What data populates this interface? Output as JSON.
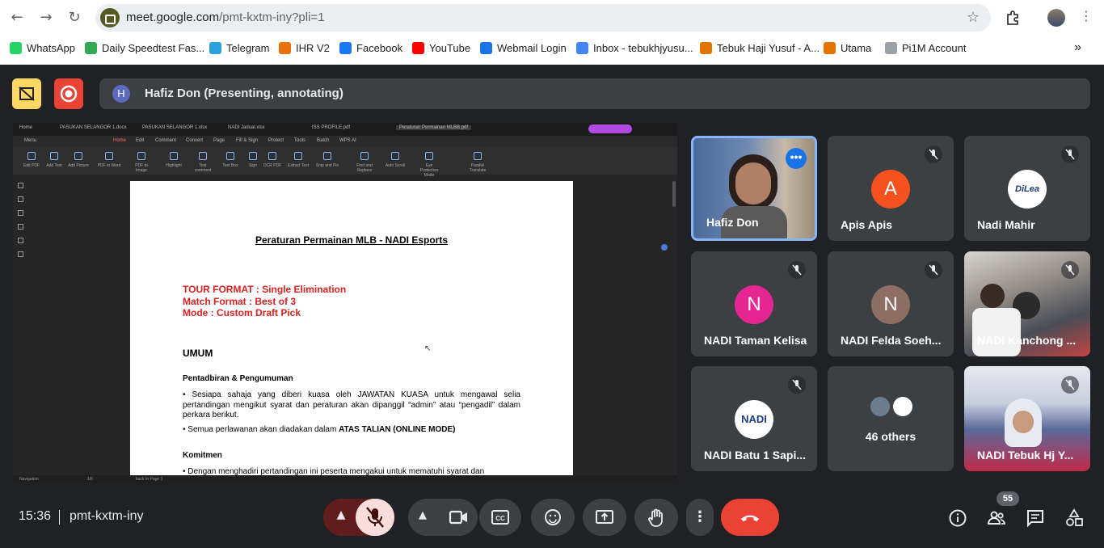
{
  "browser": {
    "url_host": "meet.google.com",
    "url_path": "/pmt-kxtm-iny?pli=1",
    "bookmarks": [
      {
        "label": "WhatsApp",
        "color": "#25d366"
      },
      {
        "label": "Daily Speedtest Fas...",
        "color": "#34a853"
      },
      {
        "label": "Telegram",
        "color": "#2aa1da"
      },
      {
        "label": "IHR V2",
        "color": "#e8710a"
      },
      {
        "label": "Facebook",
        "color": "#1877f2"
      },
      {
        "label": "YouTube",
        "color": "#ff0000"
      },
      {
        "label": "Webmail Login",
        "color": "#1a73e8"
      },
      {
        "label": "Inbox - tebukhjyusu...",
        "color": "#4285f4"
      },
      {
        "label": "Tebuk Haji Yusuf - A...",
        "color": "#e37400"
      },
      {
        "label": "Utama",
        "color": "#e37400"
      },
      {
        "label": "Pi1M Account",
        "color": "#9aa0a6"
      }
    ]
  },
  "presenter": {
    "initial": "H",
    "text": "Hafiz Don (Presenting, annotating)"
  },
  "screen": {
    "tabs": [
      "Home",
      "PASUKAN SELANGOR 1.docx",
      "PASUKAN SELANGOR 1.xlsx",
      "NADI Jadual.xlsx",
      "ISS PROFILE.pdf",
      "Peraturan Permainan MLBB.pdf"
    ],
    "menu": [
      "Menu",
      "Home",
      "Edit",
      "Comment",
      "Convert",
      "Page",
      "Fill & Sign",
      "Protect",
      "Tools",
      "Batch",
      "WPS AI"
    ],
    "ribbon": [
      "Edit PDF",
      "Add Text",
      "Add Picture",
      "PDF to Word",
      "PDF to Image",
      "Highlight",
      "Text comment",
      "Text Box",
      "Sign",
      "OCR PDF",
      "Extract Text",
      "Snip and Pin",
      "Find and Replace",
      "Auto Scroll",
      "Eye Protection Mode",
      "Parallel Translate"
    ],
    "status_left": "Navigation",
    "status_page": "1/6",
    "status_back": "back to Page 1",
    "doc": {
      "title": "Peraturan Permainan MLB - NADI Esports",
      "format_lines": [
        "TOUR FORMAT : Single Elimination",
        "Match Format : Best of 3",
        "Mode : Custom Draft Pick"
      ],
      "section": "UMUM",
      "sub1": "Pentadbiran & Pengumuman",
      "para1": "• Sesiapa sahaja yang diberi kuasa oleh JAWATAN KUASA untuk mengawal  selia pertandingan mengikut syarat dan peraturan akan dipanggil “admin” atau “pengadil” dalam perkara berikut.",
      "para2_prefix": "• Semua perlawanan akan diadakan dalam ",
      "para2_bold": "ATAS TALIAN (ONLINE MODE)",
      "sub2": "Komitmen",
      "para3": "• Dengan menghadiri pertandingan ini peserta mengakui untuk mematuhi  syarat dan"
    }
  },
  "participants": [
    {
      "name": "Hafiz Don",
      "type": "video"
    },
    {
      "name": "Apis Apis",
      "initial": "A",
      "color": "#f4511e"
    },
    {
      "name": "Nadi Mahir",
      "type": "logo",
      "logo_text": "DiLea"
    },
    {
      "name": "NADI Taman Kelisa",
      "initial": "N",
      "color": "#e52592"
    },
    {
      "name": "NADI Felda Soeh...",
      "initial": "N",
      "color": "#8d6e63"
    },
    {
      "name": "NADI Kanchong ...",
      "type": "video"
    },
    {
      "name": "NADI Batu 1 Sapi...",
      "type": "logo",
      "logo_text": "NADI"
    },
    {
      "name": "46 others",
      "type": "others"
    },
    {
      "name": "NADI Tebuk Hj Y...",
      "type": "video"
    }
  ],
  "bottom": {
    "time": "15:36",
    "meeting_code": "pmt-kxtm-iny",
    "participant_count": "55"
  }
}
